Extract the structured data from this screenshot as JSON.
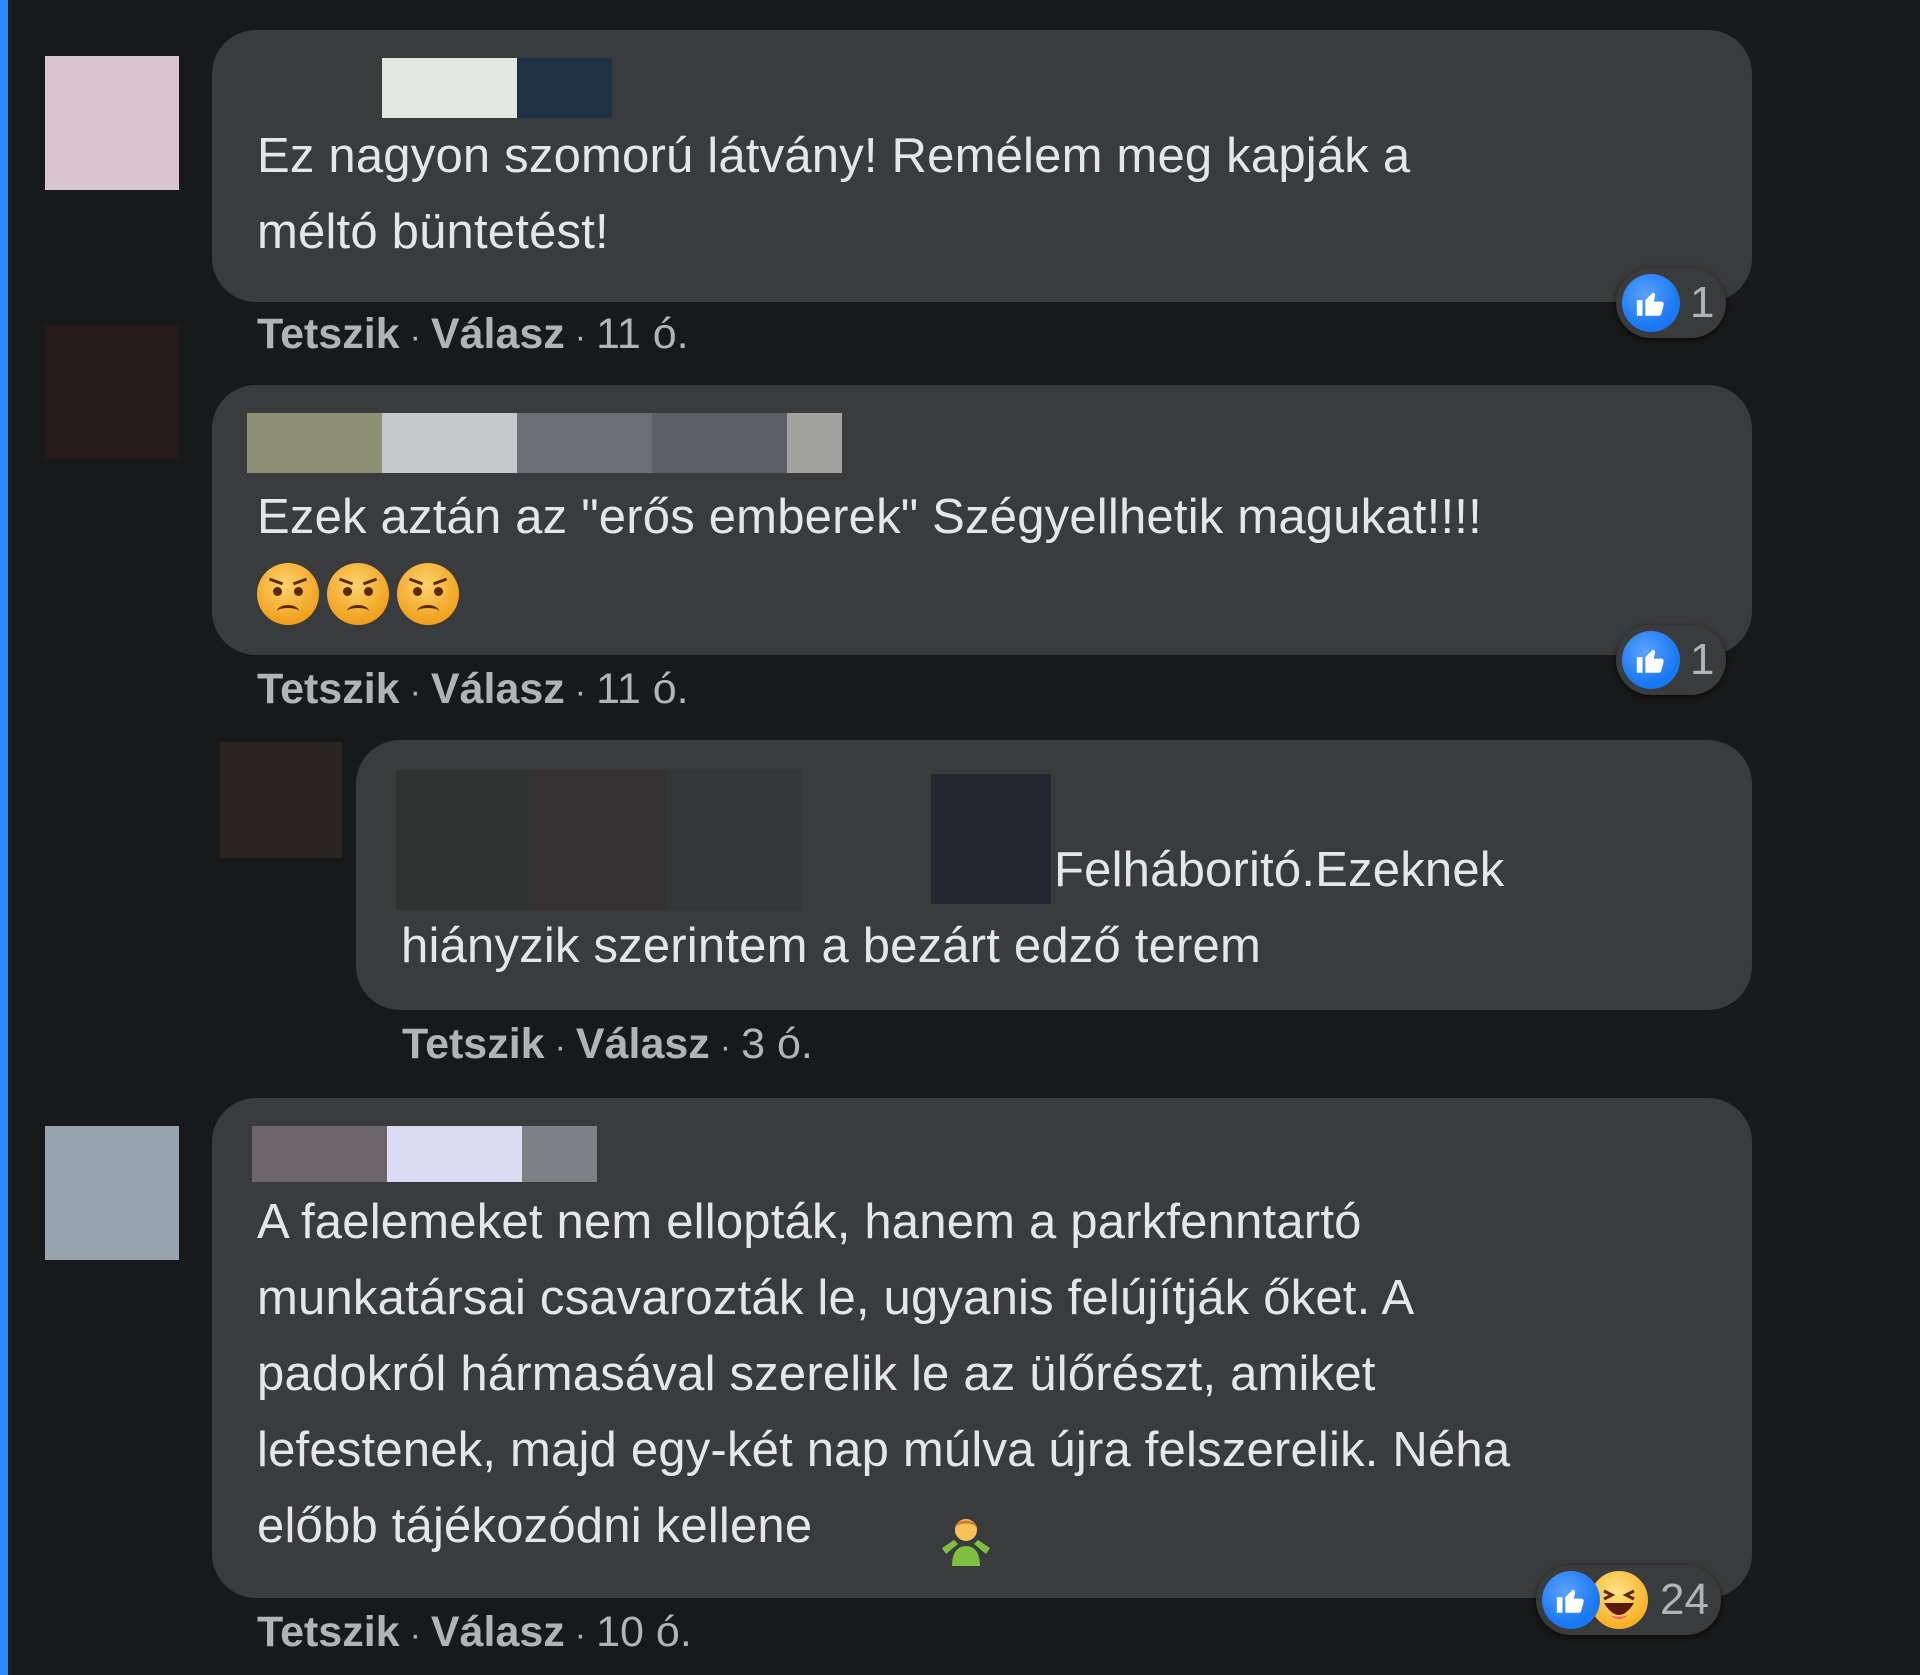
{
  "comments": [
    {
      "text": "Ez nagyon szomorú látvány! Remélem meg kapják a\nméltó büntetést!",
      "like_label": "Tetszik",
      "reply_label": "Válasz",
      "time": "11 ó.",
      "reaction_count": "1"
    },
    {
      "text": "Ezek aztán az \"erős emberek\" Szégyellhetik magukat!!!!",
      "like_label": "Tetszik",
      "reply_label": "Válasz",
      "time": "11 ó.",
      "reaction_count": "1"
    },
    {
      "text_line1": "Felháboritó.Ezeknek",
      "text_line2": "hiányzik szerintem a bezárt edző terem",
      "like_label": "Tetszik",
      "reply_label": "Válasz",
      "time": "3 ó."
    },
    {
      "text": "A faelemeket nem ellopták, hanem a parkfenntartó\nmunkatársai csavarozták le, ugyanis felújítják őket. A\npadokról hármasával szerelik le az ülőrészt, amiket\nlefestenek, majd egy-két nap múlva újra felszerelik. Néha\nelőbb tájékozódni kellene",
      "like_label": "Tetszik",
      "reply_label": "Válasz",
      "time": "10 ó.",
      "reaction_count": "24"
    }
  ],
  "separator": "·",
  "icons": {
    "like": "thumbs-up-icon",
    "haha": "haha-emoji-icon",
    "angry": "angry-face-emoji",
    "shrug": "person-shrugging-emoji"
  },
  "colors": {
    "background": "#18191a",
    "bubble": "#3a3b3c",
    "text": "#e4e6eb",
    "muted": "#b0b3b8",
    "like_blue": "#1877f2"
  }
}
